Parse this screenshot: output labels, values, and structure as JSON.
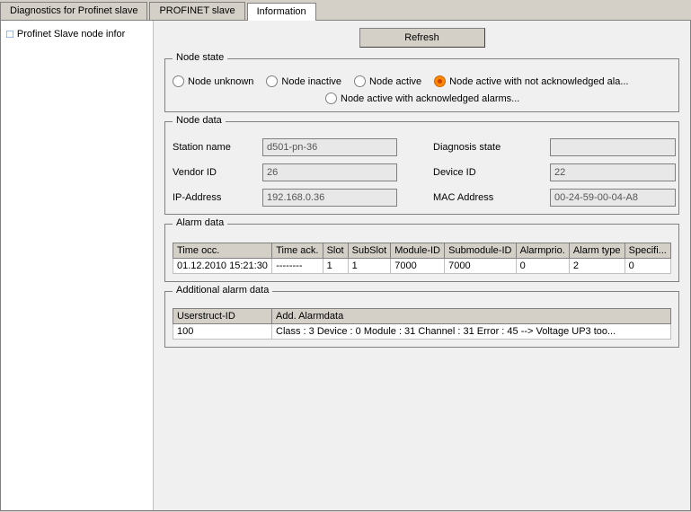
{
  "tabs": [
    {
      "label": "Diagnostics for Profinet slave",
      "active": false
    },
    {
      "label": "PROFINET slave",
      "active": false
    },
    {
      "label": "Information",
      "active": true
    }
  ],
  "sidebar": {
    "item": "Profinet Slave node infor"
  },
  "toolbar": {
    "refresh_label": "Refresh"
  },
  "node_state": {
    "legend": "Node state",
    "options": [
      {
        "label": "Node unknown",
        "selected": false
      },
      {
        "label": "Node inactive",
        "selected": false
      },
      {
        "label": "Node active",
        "selected": false
      },
      {
        "label": "Node active with not acknowledged ala...",
        "selected": true
      },
      {
        "label": "Node active with acknowledged alarms...",
        "selected": false
      }
    ]
  },
  "node_data": {
    "legend": "Node data",
    "station_name_label": "Station name",
    "station_name_value": "d501-pn-36",
    "vendor_id_label": "Vendor ID",
    "vendor_id_value": "26",
    "ip_address_label": "IP-Address",
    "ip_address_value": "192.168.0.36",
    "diagnosis_state_label": "Diagnosis state",
    "diagnosis_state_value": "",
    "device_id_label": "Device ID",
    "device_id_value": "22",
    "mac_address_label": "MAC Address",
    "mac_address_value": "00-24-59-00-04-A8"
  },
  "alarm_data": {
    "legend": "Alarm data",
    "columns": [
      "Time occ.",
      "Time ack.",
      "Slot",
      "SubSlot",
      "Module-ID",
      "Submodule-ID",
      "Alarmprio.",
      "Alarm type",
      "Specifi..."
    ],
    "rows": [
      {
        "time_occ": "01.12.2010 15:21:30",
        "time_ack": "--------",
        "slot": "1",
        "subslot": "1",
        "module_id": "7000",
        "submodule_id": "7000",
        "alarmprio": "0",
        "alarm_type": "2",
        "specific": "0"
      }
    ]
  },
  "additional_alarm_data": {
    "legend": "Additional alarm data",
    "columns": [
      "Userstruct-ID",
      "Add. Alarmdata"
    ],
    "rows": [
      {
        "userstruct_id": "100",
        "add_alarmdata": "Class : 3  Device : 0  Module : 31  Channel : 31  Error : 45 --> Voltage UP3 too..."
      }
    ]
  }
}
